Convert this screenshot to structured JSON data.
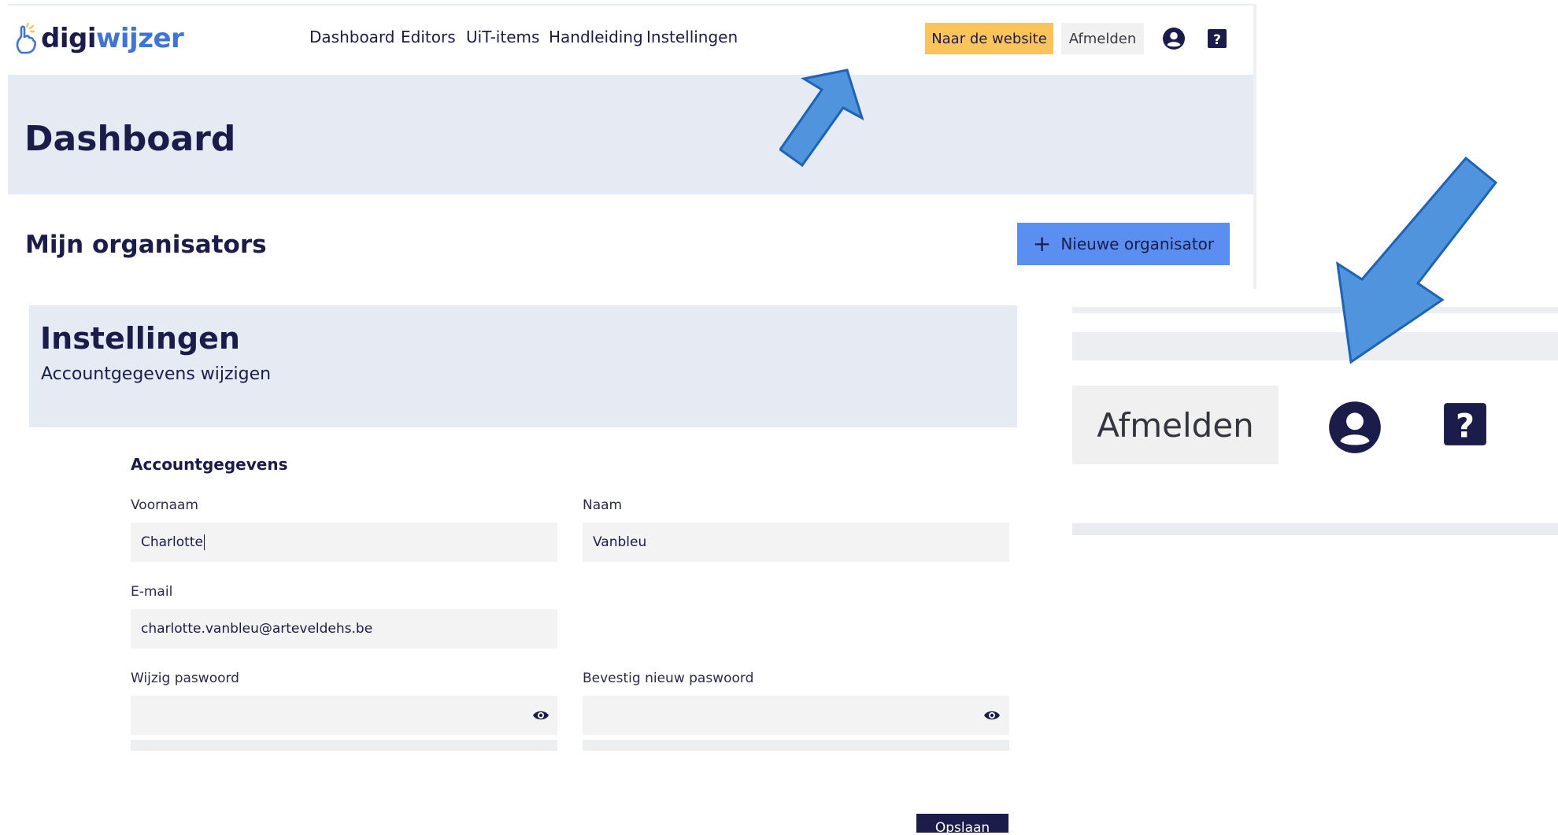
{
  "brand": {
    "part1": "digi",
    "part2": "wijzer",
    "color_dark": "#1b1c4a",
    "color_blue": "#3e74d8"
  },
  "nav": {
    "items": [
      {
        "label": "Dashboard"
      },
      {
        "label": "Editors"
      },
      {
        "label": "UiT-items"
      },
      {
        "label": "Handleiding"
      },
      {
        "label": "Instellingen"
      }
    ],
    "website_button": "Naar de website",
    "logout_button": "Afmelden",
    "user_icon": "user-circle-icon",
    "help_icon": "question-mark-icon"
  },
  "dashboard": {
    "title": "Dashboard",
    "section_title": "Mijn organisators",
    "new_button": "Nieuwe organisator"
  },
  "settings": {
    "title": "Instellingen",
    "subtitle": "Accountgegevens wijzigen",
    "section": "Accountgegevens",
    "fields": {
      "firstname": {
        "label": "Voornaam",
        "value": "Charlotte"
      },
      "lastname": {
        "label": "Naam",
        "value": "Vanbleu"
      },
      "email": {
        "label": "E-mail",
        "value": "charlotte.vanbleu@arteveldehs.be"
      },
      "password": {
        "label": "Wijzig paswoord",
        "value": ""
      },
      "password_confirm": {
        "label": "Bevestig nieuw paswoord",
        "value": ""
      }
    },
    "save_button": "Opslaan"
  },
  "zoom": {
    "logout_button": "Afmelden",
    "user_icon": "user-circle-icon",
    "help_icon": "question-mark-icon"
  },
  "colors": {
    "accent_yellow": "#fbc45a",
    "primary_blue": "#5a8ef0",
    "hero_bg": "#e6eaf3",
    "arrow_fill": "#4f94dc",
    "arrow_stroke": "#1d63b8"
  }
}
